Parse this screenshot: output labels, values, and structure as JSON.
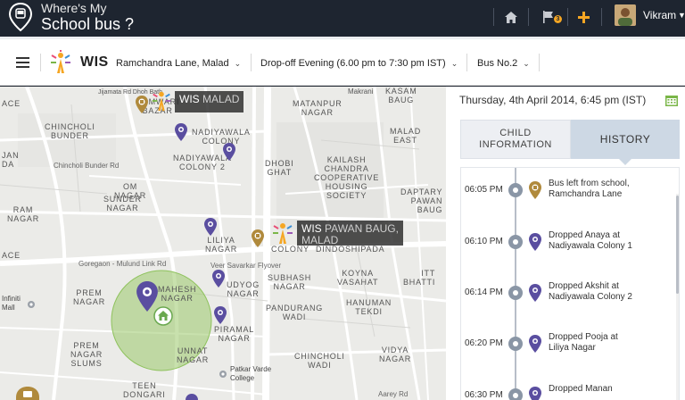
{
  "header": {
    "title_line1": "Where's My",
    "title_line2": "School bus ?",
    "user_name": "Vikram",
    "flag_badge": "3",
    "icons": [
      "home-icon",
      "flag-icon",
      "plus-icon",
      "caret-down-icon"
    ]
  },
  "filters": {
    "brand": "WIS",
    "location": "Ramchandra Lane, Malad",
    "trip": "Drop-off Evening (6.00 pm to 7:30 pm IST)",
    "bus": "Bus No.2"
  },
  "map": {
    "labels": [
      {
        "text": "ACE",
        "id": "ace-1"
      },
      {
        "text": "SOMWARI\nBAZAR",
        "id": "somwari-bazar"
      },
      {
        "text": "Jijamata Rd Dhoh Bath",
        "id": "jijamata-rd"
      },
      {
        "text": "CHINCHOLI\nBUNDER",
        "id": "chincholi-bunder"
      },
      {
        "text": "NADIYAWALA\nCOLONY",
        "id": "nadiyawala-colony"
      },
      {
        "text": "NADIYAWALA\nCOLONY 2",
        "id": "nadiyawala-colony-2"
      },
      {
        "text": "Chincholi Bunder Rd",
        "id": "chincholi-rd"
      },
      {
        "text": "OM\nNAGAR",
        "id": "om-nagar"
      },
      {
        "text": "SUNDER\nNAGAR",
        "id": "sunder-nagar"
      },
      {
        "text": "RAM\nNAGAR",
        "id": "ram-nagar"
      },
      {
        "text": "JAN\nDA",
        "id": "jan-da"
      },
      {
        "text": "MATANPUR\nNAGAR",
        "id": "matanpur-nagar"
      },
      {
        "text": "Makrani",
        "id": "makrani"
      },
      {
        "text": "KASAM\nBAUG",
        "id": "kasam-baug"
      },
      {
        "text": "MALAD\nEAST",
        "id": "malad-east"
      },
      {
        "text": "DHOBI\nGHAT",
        "id": "dhobi-ghat"
      },
      {
        "text": "KAILASH\nCHANDRA\nCOOPERATIVE\nHOUSING\nSOCIETY",
        "id": "kailash-chandra"
      },
      {
        "text": "DAPTARY\nPAWAN\nBAUG",
        "id": "pawan-baug"
      },
      {
        "text": "LILIYA\nNAGAR",
        "id": "liliya-nagar"
      },
      {
        "text": "COLONY",
        "id": "colony"
      },
      {
        "text": "DINDOSHIPADA",
        "id": "dindoshipada"
      },
      {
        "text": "ACE",
        "id": "ace-2"
      },
      {
        "text": "Goregaon - Mulund Link Rd",
        "id": "link-rd"
      },
      {
        "text": "Veer Savarkar Flyover",
        "id": "flyover"
      },
      {
        "text": "SUBHASH\nNAGAR",
        "id": "subhash-nagar"
      },
      {
        "text": "KOYNA\nVASAHAT",
        "id": "koyna-vasahat"
      },
      {
        "text": "ITT\nBHATTI",
        "id": "itt-bhatti"
      },
      {
        "text": "UDYOG\nNAGAR",
        "id": "udyog-nagar"
      },
      {
        "text": "HANUMAN\nTEKDI",
        "id": "hanuman-tekdi"
      },
      {
        "text": "PANDURANG\nWADI",
        "id": "pandurang-wadi"
      },
      {
        "text": "PREM\nNAGAR",
        "id": "prem-nagar"
      },
      {
        "text": "MAHESH\nNAGAR",
        "id": "mahesh-nagar"
      },
      {
        "text": "PIRAMAL\nNAGAR",
        "id": "piramal-nagar"
      },
      {
        "text": "PREM\nNAGAR\nSLUMS",
        "id": "prem-nagar-slums"
      },
      {
        "text": "UNNAT\nNAGAR",
        "id": "unnat-nagar"
      },
      {
        "text": "CHINCHOLI\nWADI",
        "id": "chincholi-wadi"
      },
      {
        "text": "VIDYA\nNAGAR",
        "id": "vidya-nagar"
      },
      {
        "text": "Patkar Varde\nCollege",
        "id": "patkar-varde"
      },
      {
        "text": "TEEN\nDONGARI",
        "id": "teen-dongari"
      },
      {
        "text": "Aarey Rd",
        "id": "aarey-rd"
      },
      {
        "text": "Infiniti\nMall",
        "id": "infiniti-mall"
      }
    ],
    "school_tags": [
      {
        "bold": "WIS",
        "dim": "MALAD"
      },
      {
        "bold": "WIS",
        "dim": "PAWAN BAUG,",
        "line2": "MALAD"
      }
    ]
  },
  "panel": {
    "date": "Thursday, 4th April 2014, 6:45 pm (IST)",
    "tabs": [
      {
        "label_line1": "CHILD",
        "label_line2": "INFORMATION"
      },
      {
        "label": "HISTORY"
      }
    ],
    "history": [
      {
        "time": "06:05 PM",
        "line1": "Bus left from school,",
        "line2": "Ramchandra Lane",
        "type": "school"
      },
      {
        "time": "06:10 PM",
        "line1": "Dropped Anaya  at",
        "line2": "Nadiyawala Colony 1",
        "type": "drop"
      },
      {
        "time": "06:14 PM",
        "line1": "Dropped Akshit at",
        "line2": "Nadiyawala Colony 2",
        "type": "drop"
      },
      {
        "time": "06:20 PM",
        "line1": "Dropped Pooja  at",
        "line2": "Liliya Nagar",
        "type": "drop"
      },
      {
        "time": "06:30 PM",
        "line1": "Dropped Manan",
        "line2": "",
        "type": "drop"
      }
    ]
  },
  "colors": {
    "header_bg": "#1e2530",
    "accent_orange": "#f5a623",
    "pin_purple": "#5a4ea0",
    "pin_gold": "#b08a3c",
    "geofence_green": "#9bc96a",
    "calendar_green": "#7ab648"
  }
}
